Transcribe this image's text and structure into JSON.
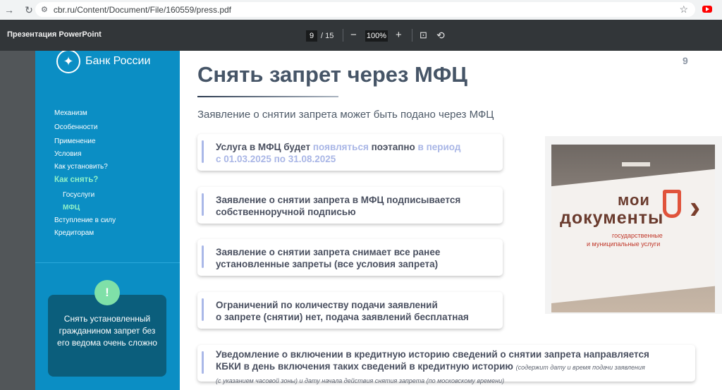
{
  "browser": {
    "url": "cbr.ru/Content/Document/File/160559/press.pdf"
  },
  "pdf_toolbar": {
    "title": "Презентация PowerPoint",
    "current_page": "9",
    "total_pages": "/ 15",
    "zoom": "100%"
  },
  "slide": {
    "logo_text": "Банк России",
    "number": "9",
    "title": "Снять запрет через МФЦ",
    "subtitle": "Заявление о снятии запрета может быть подано через МФЦ",
    "menu": [
      {
        "label": "Механизм"
      },
      {
        "label": "Особенности"
      },
      {
        "label": "Применение"
      },
      {
        "label": "Условия"
      },
      {
        "label": "Как установить?"
      },
      {
        "label": "Как снять?"
      },
      {
        "label": "Госуслуги"
      },
      {
        "label": "МФЦ"
      },
      {
        "label": "Вступление в силу"
      },
      {
        "label": "Кредиторам"
      }
    ],
    "alert": {
      "icon": "!",
      "text": "Снять установленный гражданином запрет без его ведома очень сложно"
    },
    "cards": [
      {
        "p1": "Услуга в МФЦ будет ",
        "p2": "появляться",
        "p3": " поэтапно ",
        "p4": "в период",
        "p5": "с 01.03.2025 по 31.08.2025"
      },
      {
        "line1": "Заявление о снятии запрета в МФЦ подписывается",
        "line2": "собственноручной подписью"
      },
      {
        "line1": "Заявление о снятии запрета снимает все ранее",
        "line2": "установленные запреты (все условия запрета)"
      },
      {
        "line1": "Ограничений по количеству подачи заявлений",
        "line2": "о запрете (снятии) нет, подача заявлений бесплатная"
      },
      {
        "line1": "Уведомление о включении в кредитную историю сведений о снятии запрета направляется",
        "line2": "КБКИ в день включения таких сведений в кредитную историю",
        "note1": "(содержит дату и время подачи заявления",
        "note2": "(с указанием часовой зоны) и дату начала действия снятия запрета (по московскому времени)"
      }
    ],
    "photo": {
      "sign_line1": "мои",
      "sign_line2": "документы",
      "sign_line3": "государственные",
      "sign_line4": "и муниципальные услуги"
    }
  },
  "colors": {
    "sidebar": "#0b8ec4",
    "accent_green": "#8ef0c8",
    "title": "#465567",
    "highlight": "#a9b6e6"
  }
}
